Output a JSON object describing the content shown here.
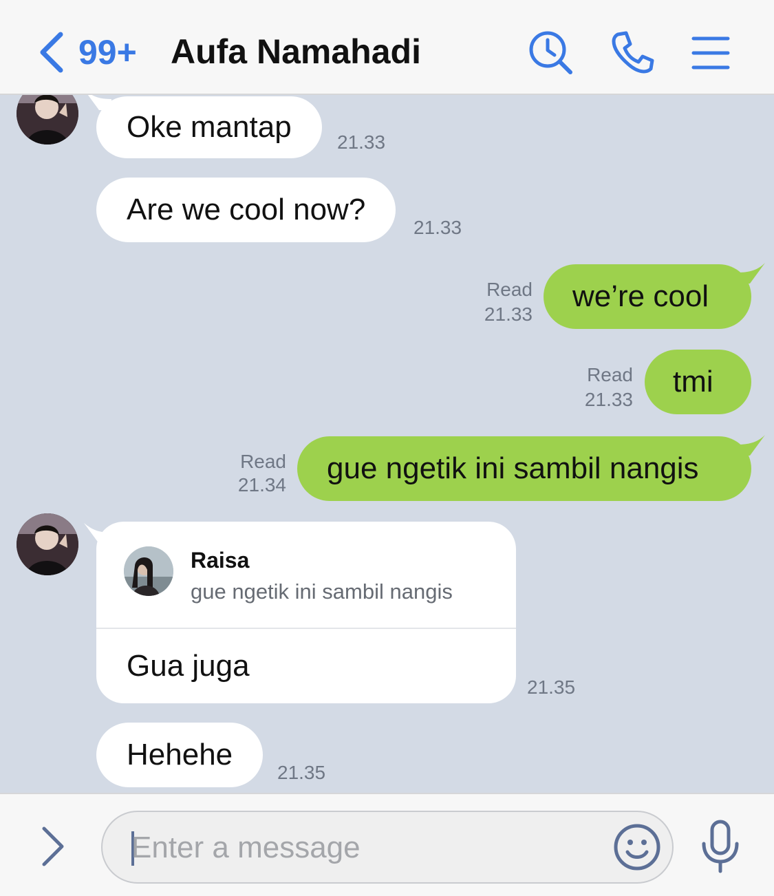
{
  "header": {
    "unread_count": "99+",
    "contact_name": "Aufa Namahadi",
    "icons": [
      "back-chevron-icon",
      "search-history-icon",
      "phone-icon",
      "menu-icon"
    ]
  },
  "messages": [
    {
      "side": "in",
      "text": "Oke mantap",
      "time": "21.33"
    },
    {
      "side": "in",
      "text": "Are we cool now?",
      "time": "21.33"
    },
    {
      "side": "out",
      "text": "we’re cool",
      "status": "Read",
      "time": "21.33"
    },
    {
      "side": "out",
      "text": "tmi",
      "status": "Read",
      "time": "21.33"
    },
    {
      "side": "out",
      "text": "gue ngetik ini sambil nangis",
      "status": "Read",
      "time": "21.34"
    },
    {
      "side": "in",
      "quote_name": "Raisa",
      "quote_text": "gue ngetik ini sambil nangis",
      "text": "Gua juga",
      "time": "21.35"
    },
    {
      "side": "in",
      "text": "Hehehe",
      "time": "21.35"
    }
  ],
  "input": {
    "placeholder": "Enter a message",
    "value": ""
  },
  "colors": {
    "accent": "#3a79e4",
    "chat_background": "#d3dae5",
    "outgoing_bubble": "#9dd14d",
    "incoming_bubble": "#ffffff"
  }
}
